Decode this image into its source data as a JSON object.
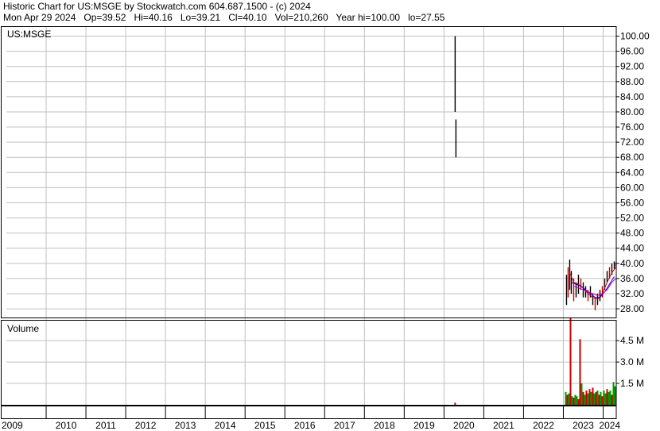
{
  "header": {
    "line1": "Historic Chart for US:MSGE by Stockwatch.com 604.687.1500 - (c) 2024",
    "line2": "Mon Apr 29 2024   Op=39.52   Hi=40.16   Lo=39.21   Cl=40.10   Vol=210,260   Year hi=100.00   lo=27.55"
  },
  "chart_data": {
    "type": "bar",
    "symbol_label": "US:MSGE",
    "volume_label": "Volume",
    "x_range": [
      2009,
      2024.33
    ],
    "xticks": [
      "2009",
      "2010",
      "2011",
      "2012",
      "2013",
      "2014",
      "2015",
      "2016",
      "2017",
      "2018",
      "2019",
      "2020",
      "2021",
      "2022",
      "2023",
      "2024"
    ],
    "price": {
      "ylim": [
        25.5,
        102
      ],
      "yticks": [
        "100.00",
        "96.00",
        "92.00",
        "88.00",
        "84.00",
        "80.00",
        "76.00",
        "72.00",
        "68.00",
        "64.00",
        "60.00",
        "56.00",
        "52.00",
        "48.00",
        "44.00",
        "40.00",
        "36.00",
        "32.00",
        "28.00"
      ],
      "series": [
        {
          "x": 2020.28,
          "low": 80.0,
          "high": 100.0,
          "color": "#000000"
        },
        {
          "x": 2020.3,
          "low": 68.0,
          "high": 78.0,
          "color": "#000000"
        },
        {
          "x": 2023.08,
          "low": 29.0,
          "high": 37.0
        },
        {
          "x": 2023.12,
          "low": 31.0,
          "high": 39.0
        },
        {
          "x": 2023.16,
          "low": 33.0,
          "high": 41.0
        },
        {
          "x": 2023.2,
          "low": 32.0,
          "high": 38.0
        },
        {
          "x": 2023.26,
          "low": 30.0,
          "high": 36.0
        },
        {
          "x": 2023.32,
          "low": 31.0,
          "high": 35.0
        },
        {
          "x": 2023.38,
          "low": 32.0,
          "high": 37.0
        },
        {
          "x": 2023.44,
          "low": 33.0,
          "high": 36.0
        },
        {
          "x": 2023.5,
          "low": 31.0,
          "high": 35.0
        },
        {
          "x": 2023.56,
          "low": 31.0,
          "high": 34.0
        },
        {
          "x": 2023.62,
          "low": 30.0,
          "high": 33.0
        },
        {
          "x": 2023.68,
          "low": 31.0,
          "high": 34.0
        },
        {
          "x": 2023.74,
          "low": 29.0,
          "high": 32.0
        },
        {
          "x": 2023.8,
          "low": 27.6,
          "high": 31.0
        },
        {
          "x": 2023.86,
          "low": 29.0,
          "high": 32.0
        },
        {
          "x": 2023.92,
          "low": 30.0,
          "high": 33.0
        },
        {
          "x": 2023.98,
          "low": 31.0,
          "high": 34.0
        },
        {
          "x": 2024.04,
          "low": 33.0,
          "high": 36.0
        },
        {
          "x": 2024.1,
          "low": 35.0,
          "high": 38.0
        },
        {
          "x": 2024.16,
          "low": 36.0,
          "high": 39.0
        },
        {
          "x": 2024.22,
          "low": 37.0,
          "high": 40.0
        },
        {
          "x": 2024.28,
          "low": 38.5,
          "high": 40.5
        },
        {
          "x": 2024.32,
          "low": 39.2,
          "high": 40.2
        }
      ],
      "moving_averages": [
        {
          "color": "#cc0000",
          "points": [
            [
              2023.16,
              37.5
            ],
            [
              2023.26,
              35.0
            ],
            [
              2023.38,
              34.5
            ],
            [
              2023.5,
              33.5
            ],
            [
              2023.62,
              32.0
            ],
            [
              2023.74,
              31.0
            ],
            [
              2023.86,
              30.5
            ],
            [
              2023.98,
              32.0
            ],
            [
              2024.1,
              35.0
            ],
            [
              2024.22,
              37.5
            ],
            [
              2024.32,
              39.0
            ]
          ]
        },
        {
          "color": "#0000cc",
          "points": [
            [
              2023.2,
              35.0
            ],
            [
              2023.32,
              34.5
            ],
            [
              2023.44,
              34.0
            ],
            [
              2023.56,
              33.0
            ],
            [
              2023.68,
              32.0
            ],
            [
              2023.8,
              31.0
            ],
            [
              2023.92,
              31.0
            ],
            [
              2024.04,
              32.5
            ],
            [
              2024.16,
              34.5
            ],
            [
              2024.28,
              36.5
            ]
          ]
        },
        {
          "color": "#cc00cc",
          "points": [
            [
              2023.26,
              34.0
            ],
            [
              2023.38,
              33.5
            ],
            [
              2023.5,
              33.0
            ],
            [
              2023.62,
              32.5
            ],
            [
              2023.74,
              32.0
            ],
            [
              2023.86,
              31.5
            ],
            [
              2023.98,
              32.0
            ],
            [
              2024.1,
              33.0
            ],
            [
              2024.22,
              35.0
            ],
            [
              2024.32,
              36.0
            ]
          ]
        }
      ]
    },
    "volume": {
      "ylim": [
        0,
        5.9
      ],
      "unit": "M",
      "yticks": [
        "4.5 M",
        "3.0 M",
        "1.5 M"
      ],
      "ytick_values": [
        4.5,
        3.0,
        1.5
      ],
      "bars": [
        {
          "x": 2020.28,
          "v": 0.15,
          "color": "#cc0000"
        },
        {
          "x": 2023.06,
          "v": 0.9,
          "color": "#009900"
        },
        {
          "x": 2023.1,
          "v": 0.7,
          "color": "#cc0000"
        },
        {
          "x": 2023.14,
          "v": 0.8,
          "color": "#009900"
        },
        {
          "x": 2023.18,
          "v": 6.1,
          "color": "#cc0000"
        },
        {
          "x": 2023.22,
          "v": 0.6,
          "color": "#009900"
        },
        {
          "x": 2023.26,
          "v": 0.5,
          "color": "#cc0000"
        },
        {
          "x": 2023.3,
          "v": 0.7,
          "color": "#009900"
        },
        {
          "x": 2023.34,
          "v": 0.6,
          "color": "#009900"
        },
        {
          "x": 2023.38,
          "v": 0.4,
          "color": "#cc0000"
        },
        {
          "x": 2023.42,
          "v": 4.6,
          "color": "#cc0000"
        },
        {
          "x": 2023.46,
          "v": 1.5,
          "color": "#009900"
        },
        {
          "x": 2023.5,
          "v": 0.9,
          "color": "#cc0000"
        },
        {
          "x": 2023.54,
          "v": 0.7,
          "color": "#009900"
        },
        {
          "x": 2023.58,
          "v": 1.0,
          "color": "#cc0000"
        },
        {
          "x": 2023.62,
          "v": 0.8,
          "color": "#009900"
        },
        {
          "x": 2023.66,
          "v": 1.1,
          "color": "#cc0000"
        },
        {
          "x": 2023.7,
          "v": 0.9,
          "color": "#009900"
        },
        {
          "x": 2023.74,
          "v": 1.2,
          "color": "#cc0000"
        },
        {
          "x": 2023.78,
          "v": 0.8,
          "color": "#009900"
        },
        {
          "x": 2023.82,
          "v": 0.9,
          "color": "#cc0000"
        },
        {
          "x": 2023.86,
          "v": 1.0,
          "color": "#009900"
        },
        {
          "x": 2023.9,
          "v": 0.7,
          "color": "#cc0000"
        },
        {
          "x": 2023.94,
          "v": 0.9,
          "color": "#009900"
        },
        {
          "x": 2023.98,
          "v": 0.6,
          "color": "#cc0000"
        },
        {
          "x": 2024.02,
          "v": 1.0,
          "color": "#009900"
        },
        {
          "x": 2024.06,
          "v": 0.8,
          "color": "#009900"
        },
        {
          "x": 2024.1,
          "v": 1.1,
          "color": "#cc0000"
        },
        {
          "x": 2024.14,
          "v": 0.9,
          "color": "#009900"
        },
        {
          "x": 2024.18,
          "v": 1.0,
          "color": "#009900"
        },
        {
          "x": 2024.22,
          "v": 0.7,
          "color": "#cc0000"
        },
        {
          "x": 2024.26,
          "v": 1.6,
          "color": "#009900"
        },
        {
          "x": 2024.3,
          "v": 1.3,
          "color": "#009900"
        }
      ]
    },
    "grid": true
  }
}
